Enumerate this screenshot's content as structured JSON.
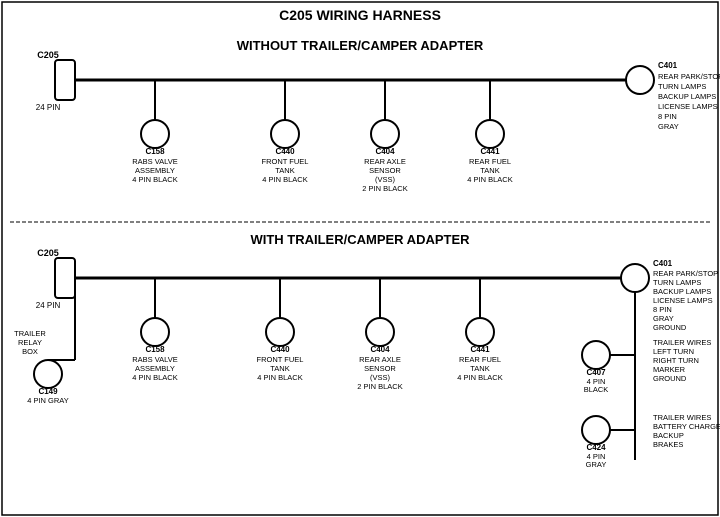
{
  "title": "C205 WIRING HARNESS",
  "section1": {
    "label": "WITHOUT TRAILER/CAMPER ADAPTER",
    "left_connector": {
      "id": "C205",
      "pins": "24 PIN"
    },
    "right_connector": {
      "id": "C401",
      "pins": "8 PIN",
      "color": "GRAY",
      "desc": "REAR PARK/STOP\nTURN LAMPS\nBACKUP LAMPS\nLICENSE LAMPS"
    },
    "connectors": [
      {
        "id": "C158",
        "desc": "RABS VALVE\nASSEMBLY\n4 PIN BLACK"
      },
      {
        "id": "C440",
        "desc": "FRONT FUEL\nTANK\n4 PIN BLACK"
      },
      {
        "id": "C404",
        "desc": "REAR AXLE\nSENSOR\n(VSS)\n2 PIN BLACK"
      },
      {
        "id": "C441",
        "desc": "REAR FUEL\nTANK\n4 PIN BLACK"
      }
    ]
  },
  "section2": {
    "label": "WITH TRAILER/CAMPER ADAPTER",
    "left_connector": {
      "id": "C205",
      "pins": "24 PIN"
    },
    "right_connector": {
      "id": "C401",
      "pins": "8 PIN",
      "color": "GRAY",
      "desc": "REAR PARK/STOP\nTURN LAMPS\nBACKUP LAMPS\nLICENSE LAMPS\nGROUND"
    },
    "extra_left": {
      "id": "C149",
      "desc": "4 PIN GRAY",
      "label": "TRAILER\nRELAY\nBOX"
    },
    "connectors": [
      {
        "id": "C158",
        "desc": "RABS VALVE\nASSEMBLY\n4 PIN BLACK"
      },
      {
        "id": "C440",
        "desc": "FRONT FUEL\nTANK\n4 PIN BLACK"
      },
      {
        "id": "C404",
        "desc": "REAR AXLE\nSENSOR\n(VSS)\n2 PIN BLACK"
      },
      {
        "id": "C441",
        "desc": "REAR FUEL\nTANK\n4 PIN BLACK"
      }
    ],
    "right_extra": [
      {
        "id": "C407",
        "desc": "4 PIN\nBLACK",
        "label": "TRAILER WIRES\nLEFT TURN\nRIGHT TURN\nMARKER\nGROUND"
      },
      {
        "id": "C424",
        "desc": "4 PIN\nGRAY",
        "label": "TRAILER WIRES\nBATTERY CHARGE\nBACKUP\nBRAKES"
      }
    ]
  }
}
